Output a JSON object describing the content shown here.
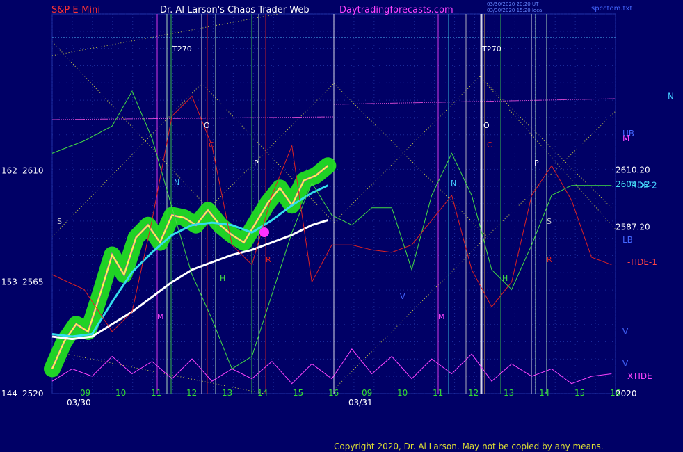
{
  "chart_data": {
    "type": "line",
    "title_left": "S&P E-Mini",
    "title_center": "Dr. Al Larson's Chaos Trader Web",
    "title_site": "Daytradingforecasts.com",
    "stamp_line1": "03/30/2020 20:20 UT",
    "stamp_line2": "03/30/2020 15:20 local",
    "filename": "spcctom.txt",
    "copyright": "Copyright 2020, Dr. Al Larson. May not be copied by any means.",
    "y_ticks": [
      {
        "left": "162",
        "price": "2610",
        "value": 2610
      },
      {
        "left": "153",
        "price": "2565",
        "value": 2565
      },
      {
        "left": "144",
        "price": "2520",
        "value": 2520
      }
    ],
    "ylim": [
      2520,
      2662
    ],
    "x_hours_day1": [
      "09",
      "10",
      "11",
      "12",
      "13",
      "14",
      "15",
      "16"
    ],
    "x_hours_day2": [
      "09",
      "10",
      "11",
      "12",
      "13",
      "14",
      "15",
      "16"
    ],
    "x_dates": [
      "03/30",
      "03/31"
    ],
    "right_labels": [
      {
        "text": "N",
        "value": 2640
      },
      {
        "text": "M",
        "value": 2623
      },
      {
        "text": "UB",
        "value": 2625
      },
      {
        "text": "2610.20",
        "value": 2610.2
      },
      {
        "text": "2604.52",
        "value": 2604.5
      },
      {
        "text": "TIDE-2",
        "value": 2604.0
      },
      {
        "text": "2587.20",
        "value": 2587.2
      },
      {
        "text": "LB",
        "value": 2582
      },
      {
        "text": "-TIDE-1",
        "value": 2573
      },
      {
        "text": "V",
        "value": 2545
      },
      {
        "text": "V",
        "value": 2532
      },
      {
        "text": "XTIDE",
        "value": 2527
      },
      {
        "text": "2020",
        "value": 2520
      }
    ],
    "markers": [
      {
        "text": "T270",
        "day": 1
      },
      {
        "text": "T270",
        "day": 2
      },
      {
        "text": "O"
      },
      {
        "text": "C"
      },
      {
        "text": "P"
      },
      {
        "text": "N"
      },
      {
        "text": "S"
      },
      {
        "text": "H"
      },
      {
        "text": "R"
      },
      {
        "text": "M"
      },
      {
        "text": "V"
      }
    ],
    "series": [
      {
        "name": "price",
        "color": "#ffff44",
        "x": [
          0.0,
          0.3,
          0.6,
          0.9,
          1.2,
          1.5,
          1.8,
          2.1,
          2.4,
          2.7,
          3.0,
          3.3,
          3.6,
          3.9,
          4.2,
          4.5,
          4.8,
          5.1,
          5.4,
          5.7,
          6.0,
          6.3,
          6.6,
          6.9
        ],
        "y": [
          2530,
          2541,
          2548,
          2545,
          2560,
          2576,
          2568,
          2583,
          2588,
          2581,
          2592,
          2591,
          2588,
          2594,
          2588,
          2584,
          2581,
          2589,
          2597,
          2603,
          2596,
          2606,
          2608,
          2612
        ]
      },
      {
        "name": "cyan-ma",
        "color": "#33ddee",
        "x": [
          0.0,
          0.5,
          1.0,
          1.5,
          2.0,
          2.5,
          3.0,
          3.5,
          4.0,
          4.5,
          5.0,
          5.5,
          6.0,
          6.5,
          6.9
        ],
        "y": [
          2544,
          2543,
          2544,
          2557,
          2569,
          2577,
          2584,
          2588,
          2589,
          2588,
          2585,
          2590,
          2596,
          2601,
          2604
        ]
      },
      {
        "name": "white-ma",
        "color": "#ffffff",
        "x": [
          0.0,
          0.5,
          1.0,
          1.5,
          2.0,
          2.5,
          3.0,
          3.5,
          4.0,
          4.5,
          5.0,
          5.5,
          6.0,
          6.5,
          6.9
        ],
        "y": [
          2543,
          2542,
          2543,
          2548,
          2553,
          2559,
          2565,
          2570,
          2573,
          2576,
          2578,
          2581,
          2584,
          2588,
          2590
        ]
      },
      {
        "name": "green-tide",
        "color": "#44dd44",
        "x": [
          0.0,
          0.8,
          1.5,
          2.0,
          2.5,
          3.0,
          3.5,
          4.0,
          4.5,
          5.0,
          5.5,
          6.0,
          6.5,
          7.0,
          7.5,
          8.0,
          8.5,
          9.0,
          9.5,
          10.0,
          10.5,
          11.0,
          11.5,
          12.0,
          12.5,
          13.0,
          13.5,
          14.0
        ],
        "y": [
          2617,
          2622,
          2628,
          2642,
          2623,
          2595,
          2568,
          2550,
          2530,
          2535,
          2560,
          2585,
          2605,
          2592,
          2588,
          2595,
          2595,
          2570,
          2600,
          2617,
          2600,
          2570,
          2562,
          2580,
          2600,
          2604,
          2604,
          2604
        ]
      },
      {
        "name": "red-tide",
        "color": "#dd2222",
        "x": [
          0.0,
          0.8,
          1.5,
          2.0,
          2.5,
          3.0,
          3.5,
          4.0,
          4.5,
          5.0,
          5.5,
          6.0,
          6.5,
          7.0,
          7.5,
          8.0,
          8.5,
          9.0,
          9.5,
          10.0,
          10.5,
          11.0,
          11.5,
          12.0,
          12.5,
          13.0,
          13.5,
          14.0
        ],
        "y": [
          2568,
          2562,
          2545,
          2553,
          2590,
          2632,
          2640,
          2620,
          2580,
          2572,
          2600,
          2620,
          2565,
          2580,
          2580,
          2578,
          2577,
          2580,
          2590,
          2600,
          2570,
          2555,
          2565,
          2600,
          2612,
          2598,
          2575,
          2572
        ]
      },
      {
        "name": "xtide",
        "color": "#ff44ff",
        "x": [
          0.0,
          0.5,
          1.0,
          1.5,
          2.0,
          2.5,
          3.0,
          3.5,
          4.0,
          4.5,
          5.0,
          5.5,
          6.0,
          6.5,
          7.0,
          7.5,
          8.0,
          8.5,
          9.0,
          9.5,
          10.0,
          10.5,
          11.0,
          11.5,
          12.0,
          12.5,
          13.0,
          13.5,
          14.0
        ],
        "y": [
          2525,
          2530,
          2527,
          2535,
          2528,
          2533,
          2526,
          2534,
          2525,
          2530,
          2526,
          2533,
          2524,
          2532,
          2526,
          2538,
          2528,
          2535,
          2526,
          2534,
          2528,
          2536,
          2525,
          2532,
          2527,
          2530,
          2524,
          2527,
          2528
        ]
      }
    ],
    "grid": true
  }
}
